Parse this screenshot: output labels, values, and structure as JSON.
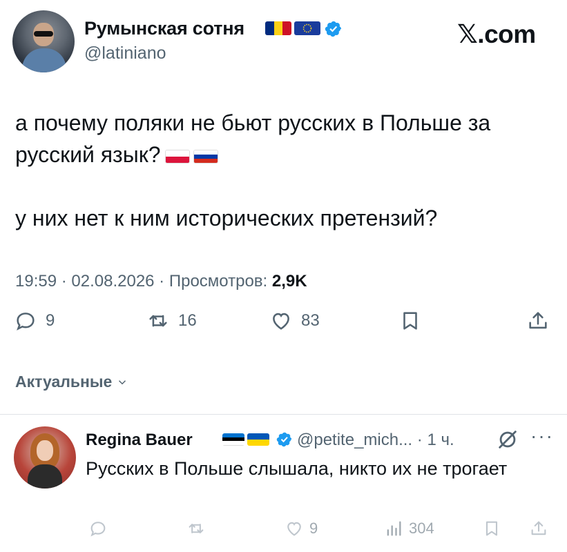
{
  "author": {
    "name": "Румынская сотня",
    "handle": "@latiniano",
    "flags": [
      "romania-flag",
      "eu-flag"
    ],
    "verified_color": "#1d9bf0"
  },
  "brand": {
    "logo_text": "𝕏.com"
  },
  "tweet": {
    "line1": "а почему поляки не бьют русских в Польше за русский язык?",
    "line1_flags": [
      "poland-flag",
      "russia-flag"
    ],
    "line2": "у них нет к ним исторических претензий?",
    "time": "19:59",
    "date": "02.08.2026",
    "views_label": "Просмотров:",
    "views_value": "2,9K",
    "separator": " · "
  },
  "actions": {
    "replies": "9",
    "reposts": "16",
    "likes": "83"
  },
  "replies_section": {
    "title": "Актуальные"
  },
  "reply": {
    "name": "Regina Bauer",
    "flags": [
      "estonia-flag",
      "ukraine-flag"
    ],
    "handle": "@petite_mich...",
    "time": "· 1 ч.",
    "text": "Русских в Польше слышала, никто их не трогает",
    "likes": "9",
    "views": "304"
  },
  "colors": {
    "text": "#0f1419",
    "secondary": "#536471",
    "verified": "#1d9bf0",
    "divider": "#dfe3e7"
  }
}
